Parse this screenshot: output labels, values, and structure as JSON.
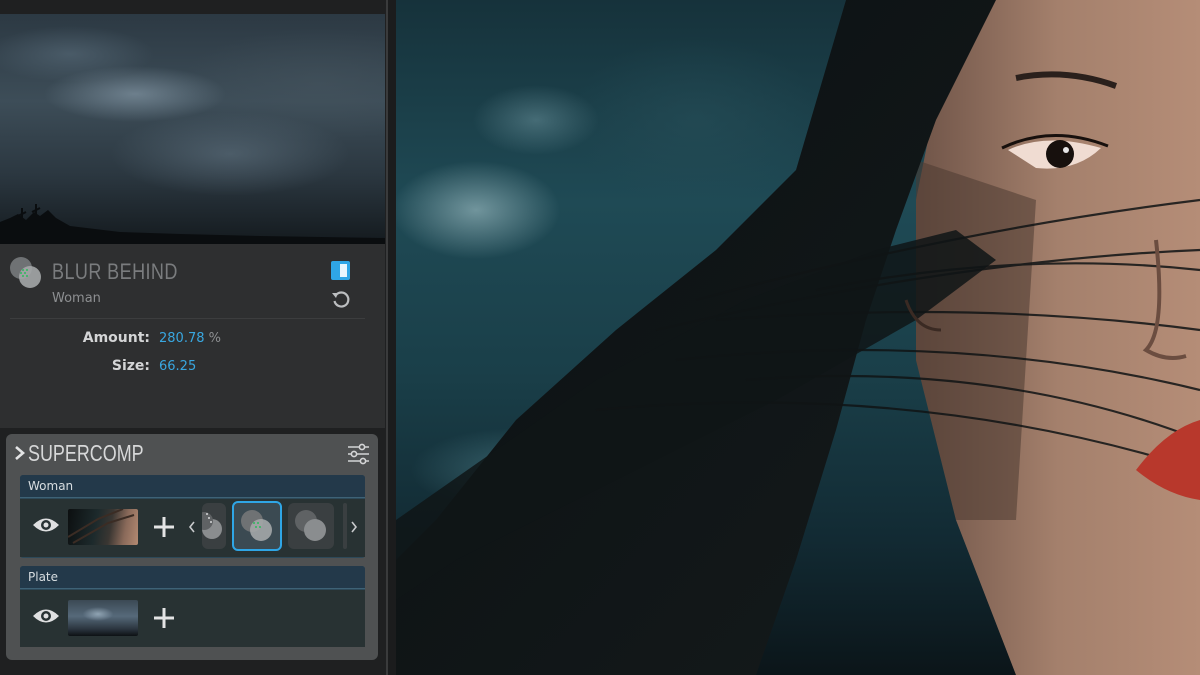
{
  "effect": {
    "title": "BLUR BEHIND",
    "layer": "Woman",
    "enabled": true,
    "params": [
      {
        "label": "Amount:",
        "value": "280.78",
        "unit": "%"
      },
      {
        "label": "Size:",
        "value": "66.25",
        "unit": ""
      }
    ]
  },
  "supercomp": {
    "title": "SUPERCOMP",
    "layers": [
      {
        "name": "Woman",
        "visible": true,
        "effects": [
          "effect-prev",
          "blur-behind",
          "effect-next"
        ]
      },
      {
        "name": "Plate",
        "visible": true,
        "effects": []
      }
    ]
  },
  "icons": {
    "effect": "venn-circles-icon",
    "reset": "reset-icon",
    "settings": "sliders-icon",
    "visibility": "eye-icon",
    "add": "plus-icon",
    "expand": "chevron-right-icon"
  },
  "colors": {
    "accent": "#2fa6e6",
    "panel": "#2e2f30",
    "layer_header": "#23394a"
  }
}
